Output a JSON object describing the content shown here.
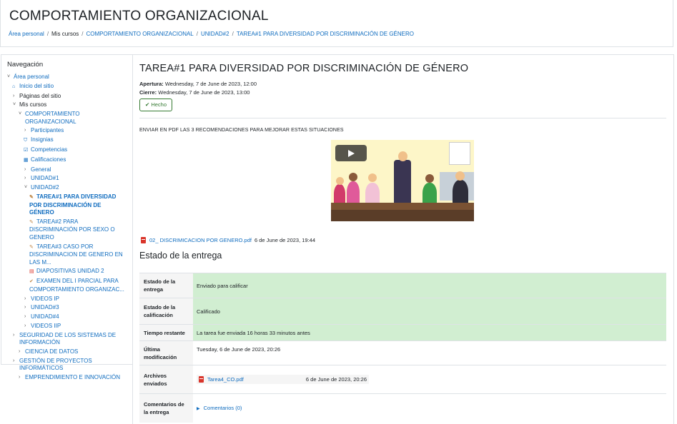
{
  "header": {
    "title": "COMPORTAMIENTO ORGANIZACIONAL",
    "breadcrumb": [
      "Área personal",
      "Mis cursos",
      "COMPORTAMIENTO ORGANIZACIONAL",
      "UNIDAD#2",
      "TAREA#1 PARA DIVERSIDAD POR DISCRIMINACIÓN DE GÉNERO"
    ]
  },
  "nav": {
    "title": "Navegación",
    "items": [
      {
        "label": "Área personal",
        "chevron": "˅"
      },
      {
        "label": "Inicio del sitio",
        "icon": "home-icon",
        "glyph": "⌂"
      },
      {
        "label": "Páginas del sitio",
        "chevron": "›"
      },
      {
        "label": "Mis cursos",
        "chevron": "˅"
      },
      {
        "label": "COMPORTAMIENTO ORGANIZACIONAL",
        "chevron": "˅"
      },
      {
        "label": "Participantes",
        "chevron": "›"
      },
      {
        "label": "Insignias",
        "icon": "shield-icon",
        "glyph": "⛉"
      },
      {
        "label": "Competencias",
        "icon": "checkbox-icon",
        "glyph": "☑"
      },
      {
        "label": "Calificaciones",
        "icon": "table-icon",
        "glyph": "▦"
      },
      {
        "label": "General",
        "chevron": "›"
      },
      {
        "label": "UNIDAD#1",
        "chevron": "›"
      },
      {
        "label": "UNIDAD#2",
        "chevron": "˅"
      },
      {
        "label": "TAREA#1 PARA DIVERSIDAD POR DISCRIMINACIÓN DE GÉNERO",
        "icon": "assignment-icon",
        "glyph": "✎"
      },
      {
        "label": "TAREA#2 PARA DISCRIMINACIÓN POR SEXO O GENERO",
        "icon": "assignment-icon",
        "glyph": "✎"
      },
      {
        "label": "TAREA#3 CASO POR DISCRIMINACION DE GENERO EN LAS M...",
        "icon": "assignment-icon",
        "glyph": "✎"
      },
      {
        "label": "DIAPOSITIVAS UNIDAD 2",
        "icon": "slides-icon",
        "glyph": "▤"
      },
      {
        "label": "EXAMEN DEL I PARCIAL PARA COMPORTAMIENTO ORGANIZAC...",
        "icon": "quiz-icon",
        "glyph": "✔"
      },
      {
        "label": "VIDEOS IP",
        "chevron": "›"
      },
      {
        "label": "UNIDAD#3",
        "chevron": "›"
      },
      {
        "label": "UNIDAD#4",
        "chevron": "›"
      },
      {
        "label": "VIDEOS IIP",
        "chevron": "›"
      },
      {
        "label": "SEGURIDAD DE LOS SISTEMAS DE INFORMACIÓN",
        "chevron": "›"
      },
      {
        "label": "CIENCIA DE DATOS",
        "chevron": "›"
      },
      {
        "label": "GESTIÓN DE PROYECTOS INFORMÁTICOS",
        "chevron": "›"
      },
      {
        "label": "EMPRENDIMIENTO E INNOVACIÓN",
        "chevron": "›"
      }
    ]
  },
  "assignment": {
    "title": "TAREA#1 PARA DIVERSIDAD POR DISCRIMINACIÓN DE GÉNERO",
    "open_label": "Apertura:",
    "open_value": "Wednesday, 7 de June de 2023, 12:00",
    "close_label": "Cierre:",
    "close_value": "Wednesday, 7 de June de 2023, 13:00",
    "done_label": "Hecho",
    "instructions": "ENVIAR EN PDF LAS 3 RECOMENDACIONES PARA MEJORAR ESTAS SITUACIONES",
    "file_name": "02_ DISCRIMICACION POR GENERO.pdf",
    "file_date": "6 de June de 2023, 19:44"
  },
  "status": {
    "heading": "Estado de la entrega",
    "rows": [
      {
        "label": "Estado de la entrega",
        "value": "Enviado para calificar"
      },
      {
        "label": "Estado de la calificación",
        "value": "Calificado"
      },
      {
        "label": "Tiempo restante",
        "value": "La tarea fue enviada 16 horas 33 minutos antes"
      },
      {
        "label": "Última modificación",
        "value": "Tuesday, 6 de June de 2023, 20:26"
      },
      {
        "label": "Archivos enviados",
        "file_name": "Tarea4_CO.pdf",
        "file_date": "6 de June de 2023, 20:26"
      },
      {
        "label": "Comentarios de la entrega",
        "value": "Comentarios (0)"
      }
    ]
  },
  "colors": {
    "link": "#0f6cbf",
    "success_green": "#357a32",
    "submitted_bg": "#d1eed1",
    "pdf_red": "#d9352b"
  }
}
